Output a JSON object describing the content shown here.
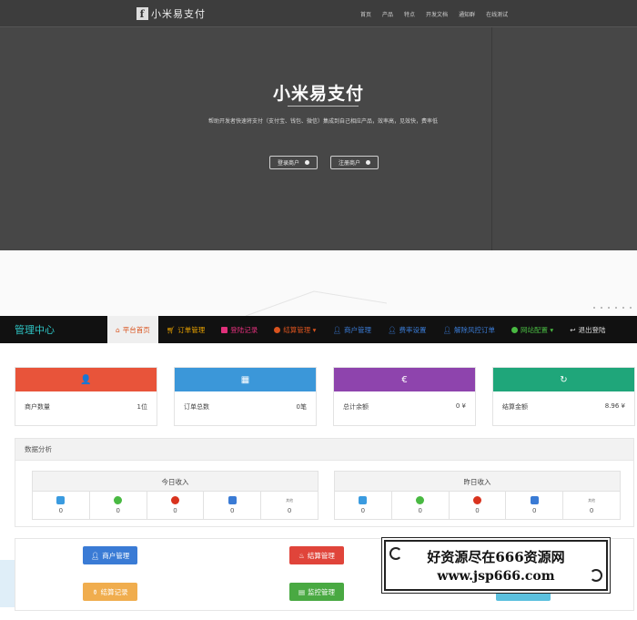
{
  "site": {
    "logo_mark": "f",
    "logo_text": "小米易支付",
    "nav": [
      "首页",
      "产品",
      "特点",
      "开发文档",
      "通知群",
      "在线测试"
    ],
    "title": "小米易支付",
    "description": "帮助开发者快速将支付（支付宝、钱包、微信）集成到自己相应产品，效率高，见效快，费率低",
    "buttons": [
      "登录商户",
      "注册商户"
    ]
  },
  "admin": {
    "brand": "管理中心",
    "nav": [
      {
        "label": "平台首页",
        "color": "#d9531e",
        "icon": "home-icon",
        "active": true
      },
      {
        "label": "订单管理",
        "color": "#e8a100",
        "icon": "cart-icon"
      },
      {
        "label": "登陆记录",
        "color": "#e0307a",
        "icon": "camera-icon"
      },
      {
        "label": "结算管理 ▾",
        "color": "#d9531e",
        "icon": "cloud-icon"
      },
      {
        "label": "商户管理",
        "color": "#3a7bd5",
        "icon": "user-icon"
      },
      {
        "label": "费率设置",
        "color": "#3a7bd5",
        "icon": "user-icon"
      },
      {
        "label": "解除风控订单",
        "color": "#3a7bd5",
        "icon": "user-icon"
      },
      {
        "label": "网站配置 ▾",
        "color": "#49b942",
        "icon": "cloud-icon"
      },
      {
        "label": "退出登陆",
        "color": "#dddddd",
        "icon": "logout-icon"
      }
    ],
    "cards": [
      {
        "label": "商户数量",
        "value": "1位",
        "color": "#e8543a",
        "icon": "user-icon",
        "glyph": "👤"
      },
      {
        "label": "订单总数",
        "value": "0笔",
        "color": "#3b97d9",
        "icon": "list-icon",
        "glyph": "▦"
      },
      {
        "label": "总计余额",
        "value": "0 ¥",
        "color": "#8e44ad",
        "icon": "euro-icon",
        "glyph": "€"
      },
      {
        "label": "结算金额",
        "value": "8.96 ¥",
        "color": "#1fa67a",
        "icon": "check-icon",
        "glyph": "↻"
      }
    ],
    "analysis_title": "数据分析",
    "today_title": "今日收入",
    "yesterday_title": "昨日收入",
    "today_values": [
      "0",
      "0",
      "0",
      "0",
      "0"
    ],
    "yesterday_values": [
      "0",
      "0",
      "0",
      "0",
      "0"
    ],
    "income_icons": [
      {
        "name": "alipay-icon",
        "color": "#3a9be0"
      },
      {
        "name": "wechat-icon",
        "color": "#49b942"
      },
      {
        "name": "qq-icon",
        "color": "#d9331e"
      },
      {
        "name": "shield-icon",
        "color": "#3a7bd5"
      },
      {
        "name": "other-icon",
        "color": "#ffffff"
      }
    ],
    "other_icon_text": "其他",
    "quick": [
      {
        "label": "商户管理",
        "color": "#3a7bd5",
        "icon": "user-icon"
      },
      {
        "label": "结算管理",
        "color": "#e0443a",
        "icon": "fire-icon"
      },
      {
        "label": "结算记录",
        "color": "#f0ad4e",
        "icon": "trophy-icon"
      },
      {
        "label": "监控管理",
        "color": "#49a942",
        "icon": "list-icon"
      }
    ]
  },
  "watermark": {
    "line1": "好资源尽在666资源网",
    "line2": "www.jsp666.com"
  }
}
